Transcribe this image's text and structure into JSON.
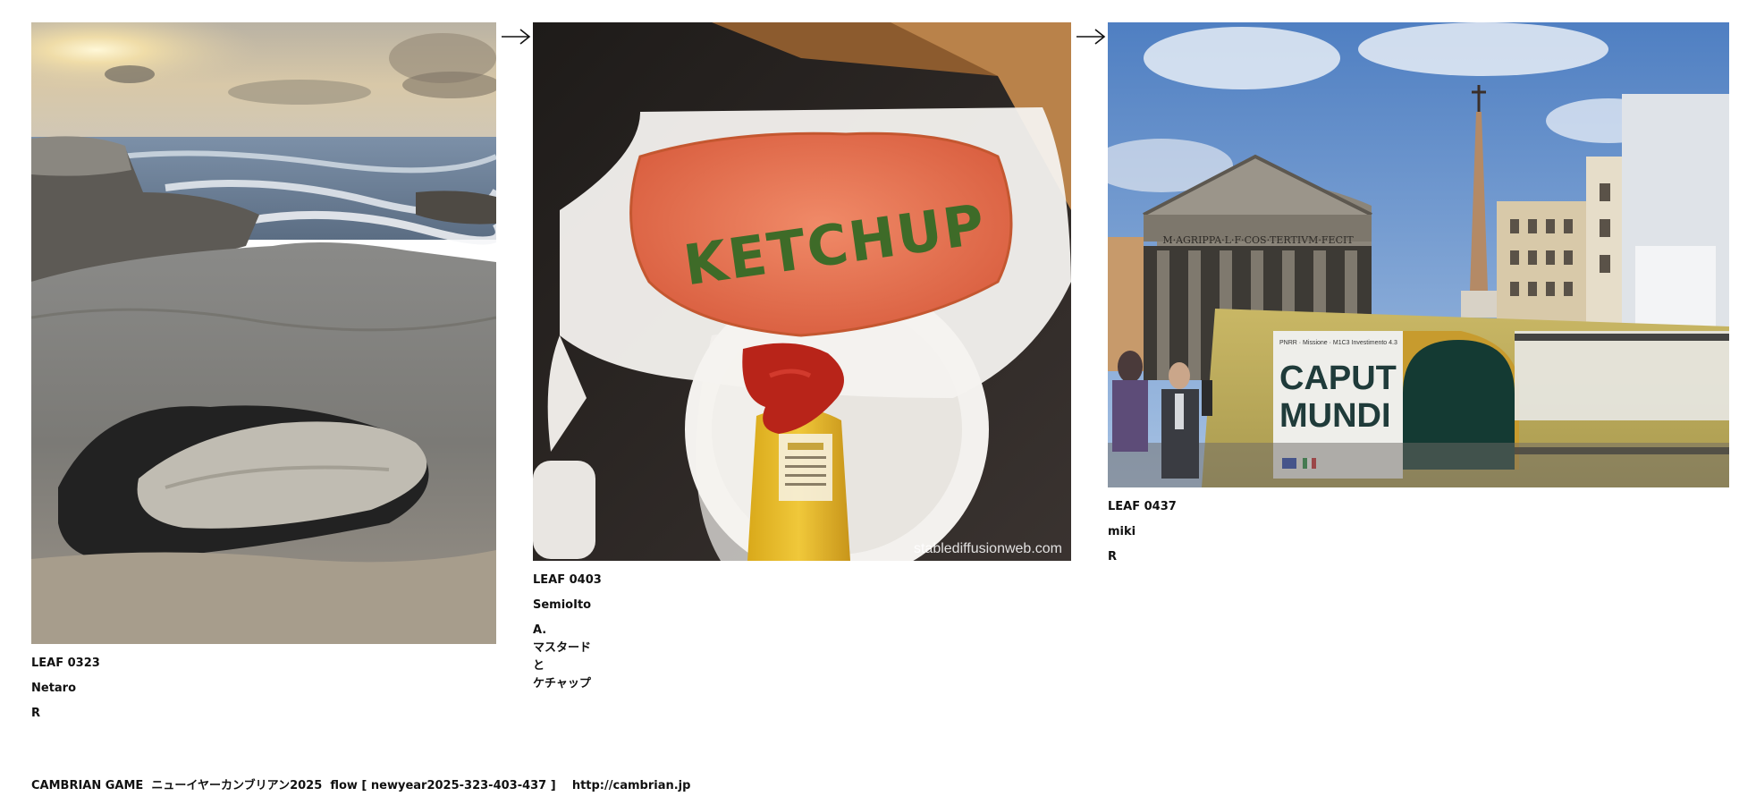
{
  "leaves": [
    {
      "id": "LEAF 0323",
      "author": "Netaro",
      "note_lines": [
        "R"
      ],
      "image": "coastal rocks with sea and cloudy sky"
    },
    {
      "id": "LEAF 0403",
      "author": "SemioIto",
      "note_lines": [
        "A.",
        "マスタード",
        "と",
        "ケチャップ"
      ],
      "image": "ketchup written in mustard on ketchup dip",
      "image_text": "KETCHUP",
      "watermark": "stablediffusionweb.com"
    },
    {
      "id": "LEAF 0437",
      "author": "miki",
      "note_lines": [
        "R"
      ],
      "image": "Pantheon in Rome with obelisk and construction hoarding",
      "image_text": {
        "inscription": "M·AGRIPPA·L·F·COS·TERTIVM·FECIT",
        "banner_title_1": "CAPUT",
        "banner_title_2": "MUNDI",
        "banner_header": "PNRR · Missione · M1C3 Investimento 4.3"
      }
    }
  ],
  "footer": {
    "game": "CAMBRIAN GAME",
    "title": "ニューイヤーカンブリアン2025",
    "flow": "flow [ newyear2025-323-403-437 ]",
    "url": "http://cambrian.jp"
  },
  "icons": {
    "between_leaves": "right-arrow-icon"
  }
}
